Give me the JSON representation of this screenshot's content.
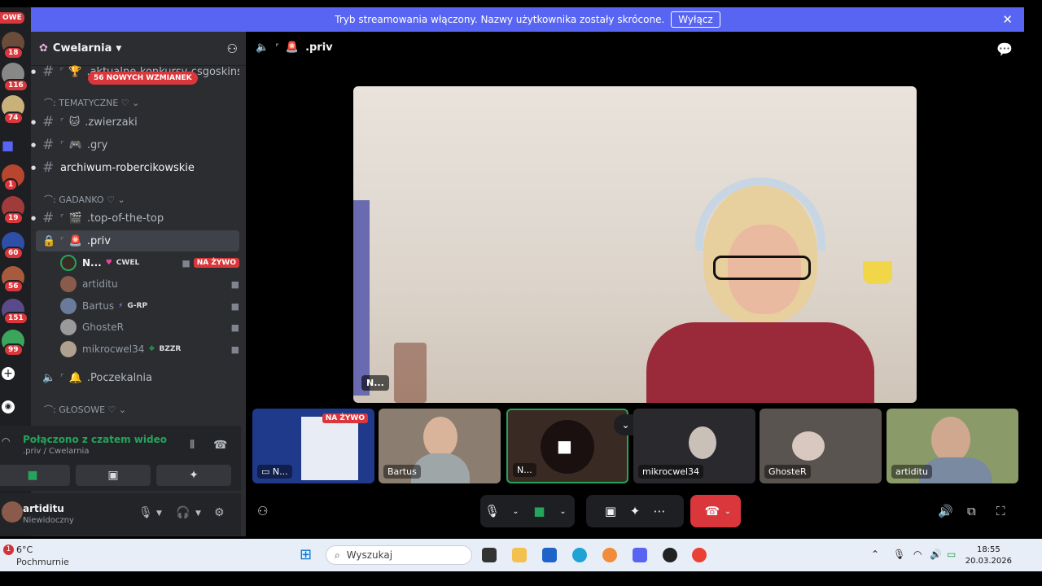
{
  "banner": {
    "text": "Tryb streamowania włączony. Nazwy użytkownika zostały skrócone.",
    "button": "Wyłącz"
  },
  "rail": {
    "top_label": "OWE",
    "counts": [
      "18",
      "116",
      "74",
      "1",
      "19",
      "60",
      "56",
      "151",
      "99"
    ]
  },
  "guild": {
    "name": "Cwelarnia"
  },
  "mention_pill": "56 NOWYCH WZMIANEK",
  "channels": {
    "aktualne": ".aktualne-konkursy-csgoskins",
    "cat_tematyczne": "TEMATYCZNE ♡",
    "zwierzaki": ".zwierzaki",
    "gry": ".gry",
    "archiwum": "archiwum-robercikowskie",
    "cat_gadanko": "GADANKO ♡",
    "topofthetop": ".top-of-the-top",
    "priv": ".priv",
    "poczekalnia": ".Poczekalnia",
    "cat_glosowe": "GŁOSOWE ♡"
  },
  "voice_users": [
    {
      "name": "N...",
      "tag": "CWEL",
      "live": "NA ŻYWO"
    },
    {
      "name": "artiditu",
      "tag": ""
    },
    {
      "name": "Bartus",
      "tag": "G-RP"
    },
    {
      "name": "GhosteR",
      "tag": ""
    },
    {
      "name": "mikrocwel34",
      "tag": "BZZR"
    }
  ],
  "voice_panel": {
    "status": "Połączono z czatem wideo",
    "location": ".priv / Cwelarnia"
  },
  "user": {
    "name": "artiditu",
    "status": "Niewidoczny"
  },
  "stage": {
    "channel": ".priv",
    "main_label": "N..."
  },
  "tiles": [
    {
      "label": "N...",
      "live": "NA ŻYWO"
    },
    {
      "label": "Bartus"
    },
    {
      "label": "N..."
    },
    {
      "label": "mikrocwel34"
    },
    {
      "label": "GhosteR"
    },
    {
      "label": "artiditu"
    }
  ],
  "taskbar": {
    "temp": "6°C",
    "weather": "Pochmurnie",
    "weather_badge": "1",
    "search": "Wyszukaj",
    "time": "18:55",
    "date": "20.03.2026"
  },
  "colors": {
    "accent": "#5865f2",
    "danger": "#da373c",
    "online": "#23a55a"
  }
}
